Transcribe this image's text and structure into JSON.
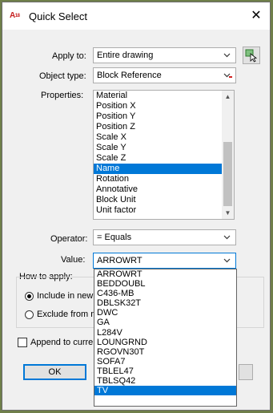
{
  "dialog": {
    "title": "Quick Select",
    "app_icon_text": "A",
    "app_icon_sub": "18",
    "close_glyph": "✕"
  },
  "fields": {
    "apply_to": {
      "label": "Apply to:",
      "value": "Entire drawing"
    },
    "object_type": {
      "label": "Object type:",
      "value": "Block Reference"
    },
    "properties": {
      "label": "Properties:",
      "items": [
        "Material",
        "Position X",
        "Position Y",
        "Position Z",
        "Scale X",
        "Scale Y",
        "Scale Z",
        "Name",
        "Rotation",
        "Annotative",
        "Block Unit",
        "Unit factor"
      ],
      "selected": "Name"
    },
    "operator": {
      "label": "Operator:",
      "value": "= Equals"
    },
    "value": {
      "label": "Value:",
      "value": "ARROWRT"
    }
  },
  "value_options": [
    "ARROWRT",
    "BEDDOUBL",
    "C436-MB",
    "DBLSK32T",
    "DWC",
    "GA",
    "L284V",
    "LOUNGRND",
    "RGOVN30T",
    "SOFA7",
    "TBLEL47",
    "TBLSQ42",
    "TV"
  ],
  "value_selected": "TV",
  "how_to_apply": {
    "label": "How to apply:",
    "include_label": "Include in new",
    "exclude_label": "Exclude from n"
  },
  "append_label": "Append to curren",
  "ok_label": "OK",
  "icons": {
    "dropdown": "chevron-down-icon",
    "select_objects": "select-objects-icon"
  },
  "colors": {
    "accent": "#0078d7",
    "app_red": "#c62020"
  }
}
